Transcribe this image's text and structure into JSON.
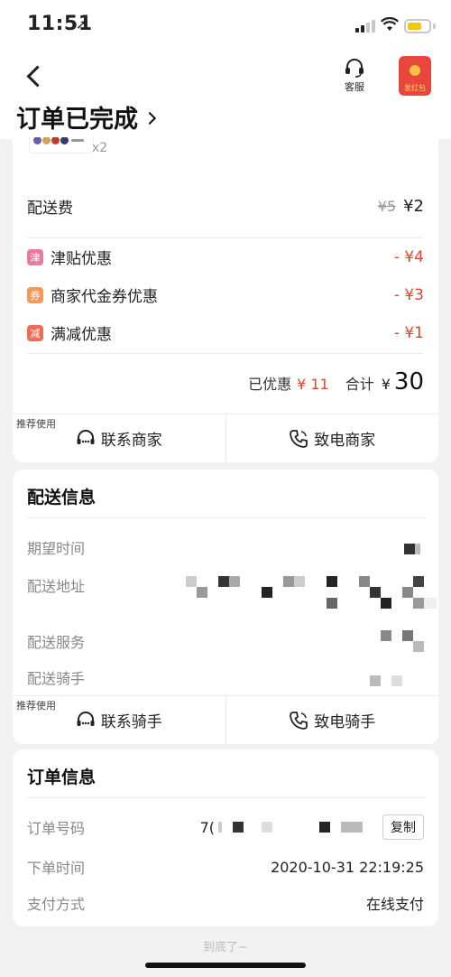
{
  "status_bar": {
    "time": "11:51"
  },
  "header": {
    "service_label": "客服",
    "redpacket_label": "发红包",
    "page_title": "订单已完成"
  },
  "order_items": {
    "quantity": "x2"
  },
  "fees": {
    "delivery_label": "配送费",
    "delivery_original": "¥5",
    "delivery_actual": "¥2"
  },
  "discounts": [
    {
      "badge": "津",
      "label": "津贴优惠",
      "amount": "- ¥4",
      "color": "#e9799d"
    },
    {
      "badge": "券",
      "label": "商家代金券优惠",
      "amount": "- ¥3",
      "color": "#f09a5a"
    },
    {
      "badge": "减",
      "label": "满减优惠",
      "amount": "- ¥1",
      "color": "#ef6a57"
    }
  ],
  "summary": {
    "saved_label": "已优惠",
    "saved_amount": "¥ 11",
    "total_label": "合计",
    "total_currency": "¥",
    "total_amount": "30"
  },
  "merchant_actions": {
    "recommend_tag": "推荐使用",
    "contact_label": "联系商家",
    "call_label": "致电商家"
  },
  "delivery_info": {
    "title": "配送信息",
    "rows": [
      {
        "label": "期望时间"
      },
      {
        "label": "配送地址"
      },
      {
        "label": "配送服务"
      },
      {
        "label": "配送骑手"
      }
    ]
  },
  "rider_actions": {
    "recommend_tag": "推荐使用",
    "contact_label": "联系骑手",
    "call_label": "致电骑手"
  },
  "order_info": {
    "title": "订单信息",
    "order_no_label": "订单号码",
    "order_no_prefix": "7(",
    "copy_label": "复制",
    "order_time_label": "下单时间",
    "order_time": "2020-10-31 22:19:25",
    "payment_label": "支付方式",
    "payment_method": "在线支付"
  },
  "footer": {
    "end_text": "到底了~"
  }
}
